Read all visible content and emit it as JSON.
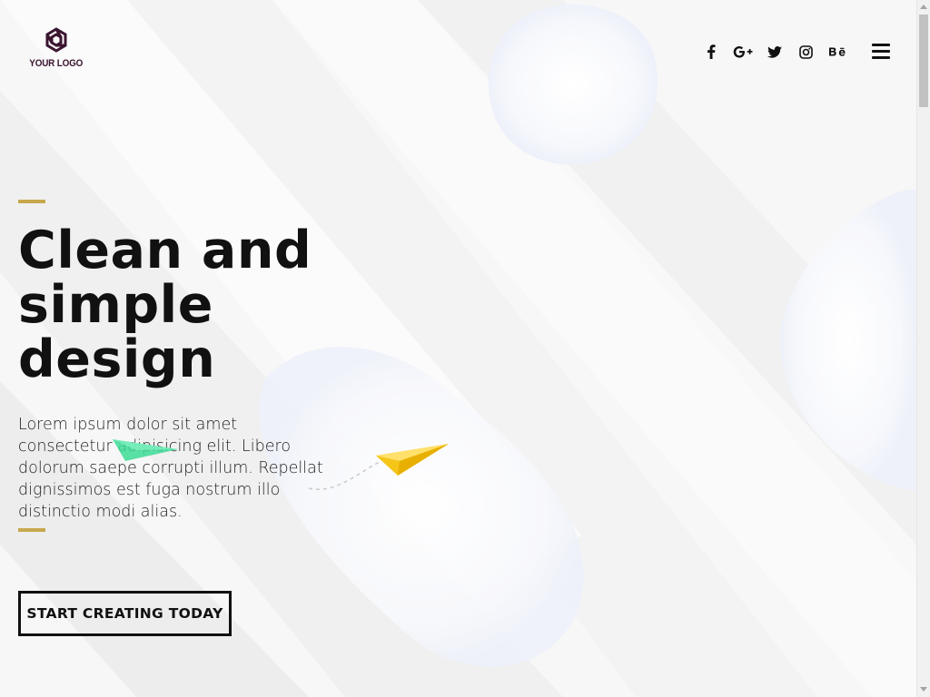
{
  "header": {
    "logo_text": "YOUR LOGO",
    "social": [
      {
        "icon": "facebook-icon",
        "glyph": "f"
      },
      {
        "icon": "google-plus-icon",
        "glyph": "G+"
      },
      {
        "icon": "twitter-icon",
        "glyph": "t"
      },
      {
        "icon": "instagram-icon",
        "glyph": "ig"
      },
      {
        "icon": "behance-icon",
        "glyph": "Bē"
      }
    ],
    "menu_icon": "hamburger-menu-icon"
  },
  "hero": {
    "title": "Clean and simple design",
    "description": "Lorem ipsum dolor sit amet consectetur adipisicing elit. Libero dolorum saepe corrupti illum. Repellat dignissimos est fuga nostrum illo distinctio modi alias.",
    "cta_label": "START CREATING TODAY"
  },
  "colors": {
    "accent": "#c8a84e",
    "text": "#111111",
    "logo": "#3b1530",
    "plane_yellow": "#f5c518",
    "plane_green": "#3ddc97"
  }
}
